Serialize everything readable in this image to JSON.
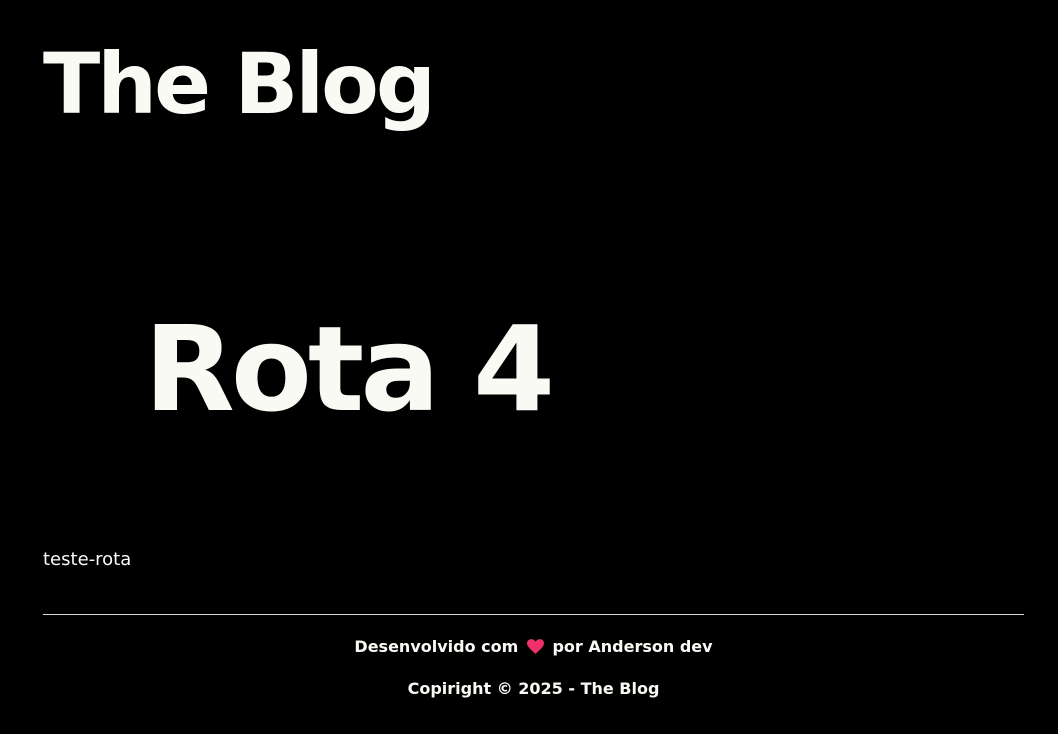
{
  "header": {
    "title": "The Blog"
  },
  "main": {
    "heading": "Rota 4",
    "text": "teste-rota"
  },
  "footer": {
    "credit_prefix": "Desenvolvido com",
    "credit_icon": "heart-icon",
    "credit_suffix": "por Anderson dev",
    "copyright": "Copiright © 2025 - The Blog"
  },
  "colors": {
    "background": "#000000",
    "text": "#fafaf5",
    "heart": "#f0306a",
    "divider": "#d8d8d8"
  }
}
